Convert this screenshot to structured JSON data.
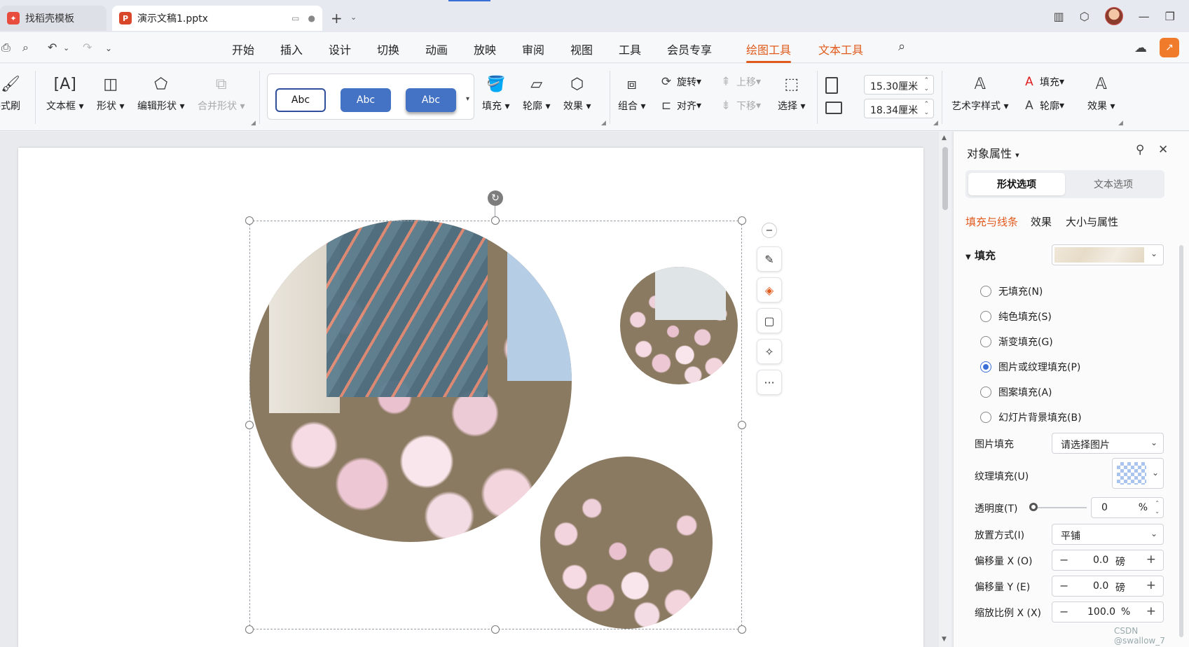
{
  "tabs": [
    {
      "icon": "wps-icon",
      "label": "找稻壳模板",
      "color": "#e84c3d"
    },
    {
      "icon": "P",
      "label": "演示文稿1.pptx",
      "color": "#d9472b"
    }
  ],
  "menu": {
    "items": [
      "开始",
      "插入",
      "设计",
      "切换",
      "动画",
      "放映",
      "审阅",
      "视图",
      "工具",
      "会员专享",
      "绘图工具",
      "文本工具"
    ],
    "selected": "绘图工具"
  },
  "ribbon": {
    "format_painter": "格式刷",
    "textbox": "文本框",
    "shape": "形状",
    "edit_shape": "编辑形状",
    "merge_shape": "合并形状",
    "styles": [
      "Abc",
      "Abc",
      "Abc"
    ],
    "fill": "填充",
    "outline": "轮廓",
    "effect": "效果",
    "group": "组合",
    "rotate": "旋转",
    "align": "对齐",
    "move_up": "上移",
    "move_down": "下移",
    "select": "选择",
    "width": "15.30厘米",
    "height": "18.34厘米",
    "art_style": "艺术字样式",
    "text_fill": "填充",
    "text_outline": "轮廓",
    "text_effect": "效果"
  },
  "panel": {
    "title": "对象属性",
    "seg_shape": "形状选项",
    "seg_text": "文本选项",
    "sub_fill_line": "填充与线条",
    "sub_effect": "效果",
    "sub_size": "大小与属性",
    "fill_section": "填充",
    "radios": [
      {
        "label": "无填充(N)",
        "checked": false
      },
      {
        "label": "纯色填充(S)",
        "checked": false
      },
      {
        "label": "渐变填充(G)",
        "checked": false
      },
      {
        "label": "图片或纹理填充(P)",
        "checked": true
      },
      {
        "label": "图案填充(A)",
        "checked": false
      },
      {
        "label": "幻灯片背景填充(B)",
        "checked": false
      }
    ],
    "pic_fill_label": "图片填充",
    "pic_fill_value": "请选择图片",
    "texture_label": "纹理填充(U)",
    "transparency_label": "透明度(T)",
    "transparency_value": "0",
    "transparency_unit": "%",
    "placement_label": "放置方式(I)",
    "placement_value": "平铺",
    "offset_x_label": "偏移量 X (O)",
    "offset_x_value": "0.0",
    "offset_y_label": "偏移量 Y (E)",
    "offset_y_value": "0.0",
    "offset_unit": "磅",
    "scale_x_label": "缩放比例 X (X)",
    "scale_x_value": "100.0",
    "scale_unit": "%"
  },
  "watermark": "CSDN @swallow_7"
}
